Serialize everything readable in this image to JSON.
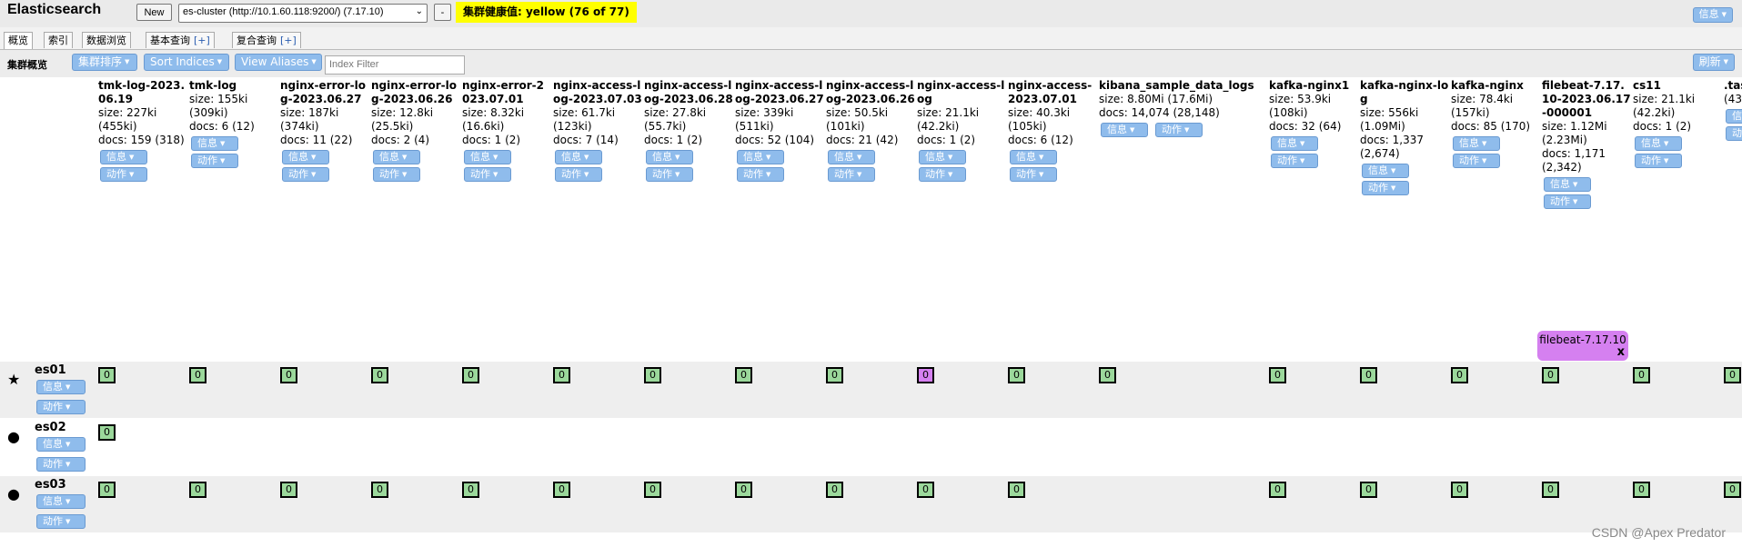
{
  "header": {
    "title": "Elasticsearch",
    "new_button": "New",
    "cluster_url": "es-cluster (http://10.1.60.118:9200/) (7.17.10)",
    "dash_button": "-",
    "health": "集群健康值: yellow (76 of 77)",
    "info_button": "信息"
  },
  "tabs": [
    {
      "label": "概览",
      "plus": ""
    },
    {
      "label": "索引",
      "plus": ""
    },
    {
      "label": "数据浏览",
      "plus": ""
    },
    {
      "label": "基本查询",
      "plus": "[+]"
    },
    {
      "label": "复合查询",
      "plus": "[+]"
    }
  ],
  "toolbar": {
    "label": "集群概览",
    "sort_cluster": "集群排序",
    "sort_indices": "Sort Indices",
    "view_aliases": "View Aliases",
    "filter_placeholder": "Index Filter",
    "refresh": "刷新"
  },
  "buttons": {
    "info": "信息",
    "action": "动作"
  },
  "indices": [
    {
      "name": "tmk-log-2023.06.19",
      "size": "size: 227ki (455ki)",
      "docs": "docs: 159 (318)"
    },
    {
      "name": "tmk-log",
      "size": "size: 155ki (309ki)",
      "docs": "docs: 6 (12)"
    },
    {
      "name": "nginx-error-log-2023.06.27",
      "size": "size: 187ki (374ki)",
      "docs": "docs: 11 (22)"
    },
    {
      "name": "nginx-error-log-2023.06.26",
      "size": "size: 12.8ki (25.5ki)",
      "docs": "docs: 2 (4)"
    },
    {
      "name": "nginx-error-2023.07.01",
      "size": "size: 8.32ki (16.6ki)",
      "docs": "docs: 1 (2)"
    },
    {
      "name": "nginx-access-log-2023.07.03",
      "size": "size: 61.7ki (123ki)",
      "docs": "docs: 7 (14)"
    },
    {
      "name": "nginx-access-log-2023.06.28",
      "size": "size: 27.8ki (55.7ki)",
      "docs": "docs: 1 (2)"
    },
    {
      "name": "nginx-access-log-2023.06.27",
      "size": "size: 339ki (511ki)",
      "docs": "docs: 52 (104)"
    },
    {
      "name": "nginx-access-log-2023.06.26",
      "size": "size: 50.5ki (101ki)",
      "docs": "docs: 21 (42)"
    },
    {
      "name": "nginx-access-log",
      "size": "size: 21.1ki (42.2ki)",
      "docs": "docs: 1 (2)"
    },
    {
      "name": "nginx-access-2023.07.01",
      "size": "size: 40.3ki (105ki)",
      "docs": "docs: 6 (12)"
    },
    {
      "name": "kibana_sample_data_logs",
      "size": "size: 8.80Mi (17.6Mi)",
      "docs": "docs: 14,074 (28,148)"
    },
    {
      "name": "kafka-nginx1",
      "size": "size: 53.9ki (108ki)",
      "docs": "docs: 32 (64)"
    },
    {
      "name": "kafka-nginx-log",
      "size": "size: 556ki (1.09Mi)",
      "docs": "docs: 1,337 (2,674)"
    },
    {
      "name": "kafka-nginx",
      "size": "size: 78.4ki (157ki)",
      "docs": "docs: 85 (170)"
    },
    {
      "name": "filebeat-7.17.10-2023.06.17-000001",
      "size": "size: 1.12Mi (2.23Mi)",
      "docs": "docs: 1,171 (2,342)"
    },
    {
      "name": "cs11",
      "size": "size: 21.1ki (42.2ki)",
      "docs": "docs: 1 (2)"
    },
    {
      "name": ".tas",
      "size": "(43",
      "docs": ""
    }
  ],
  "alias": {
    "label": "filebeat-7.17.10",
    "close": "x"
  },
  "nodes": [
    {
      "name": "es01",
      "icon": "star-icon",
      "symbol": "★"
    },
    {
      "name": "es02",
      "icon": "circle-icon",
      "symbol": "●"
    },
    {
      "name": "es03",
      "icon": "circle-icon",
      "symbol": "●"
    }
  ],
  "shard_label": "0",
  "watermark": "CSDN @Apex   Predator"
}
